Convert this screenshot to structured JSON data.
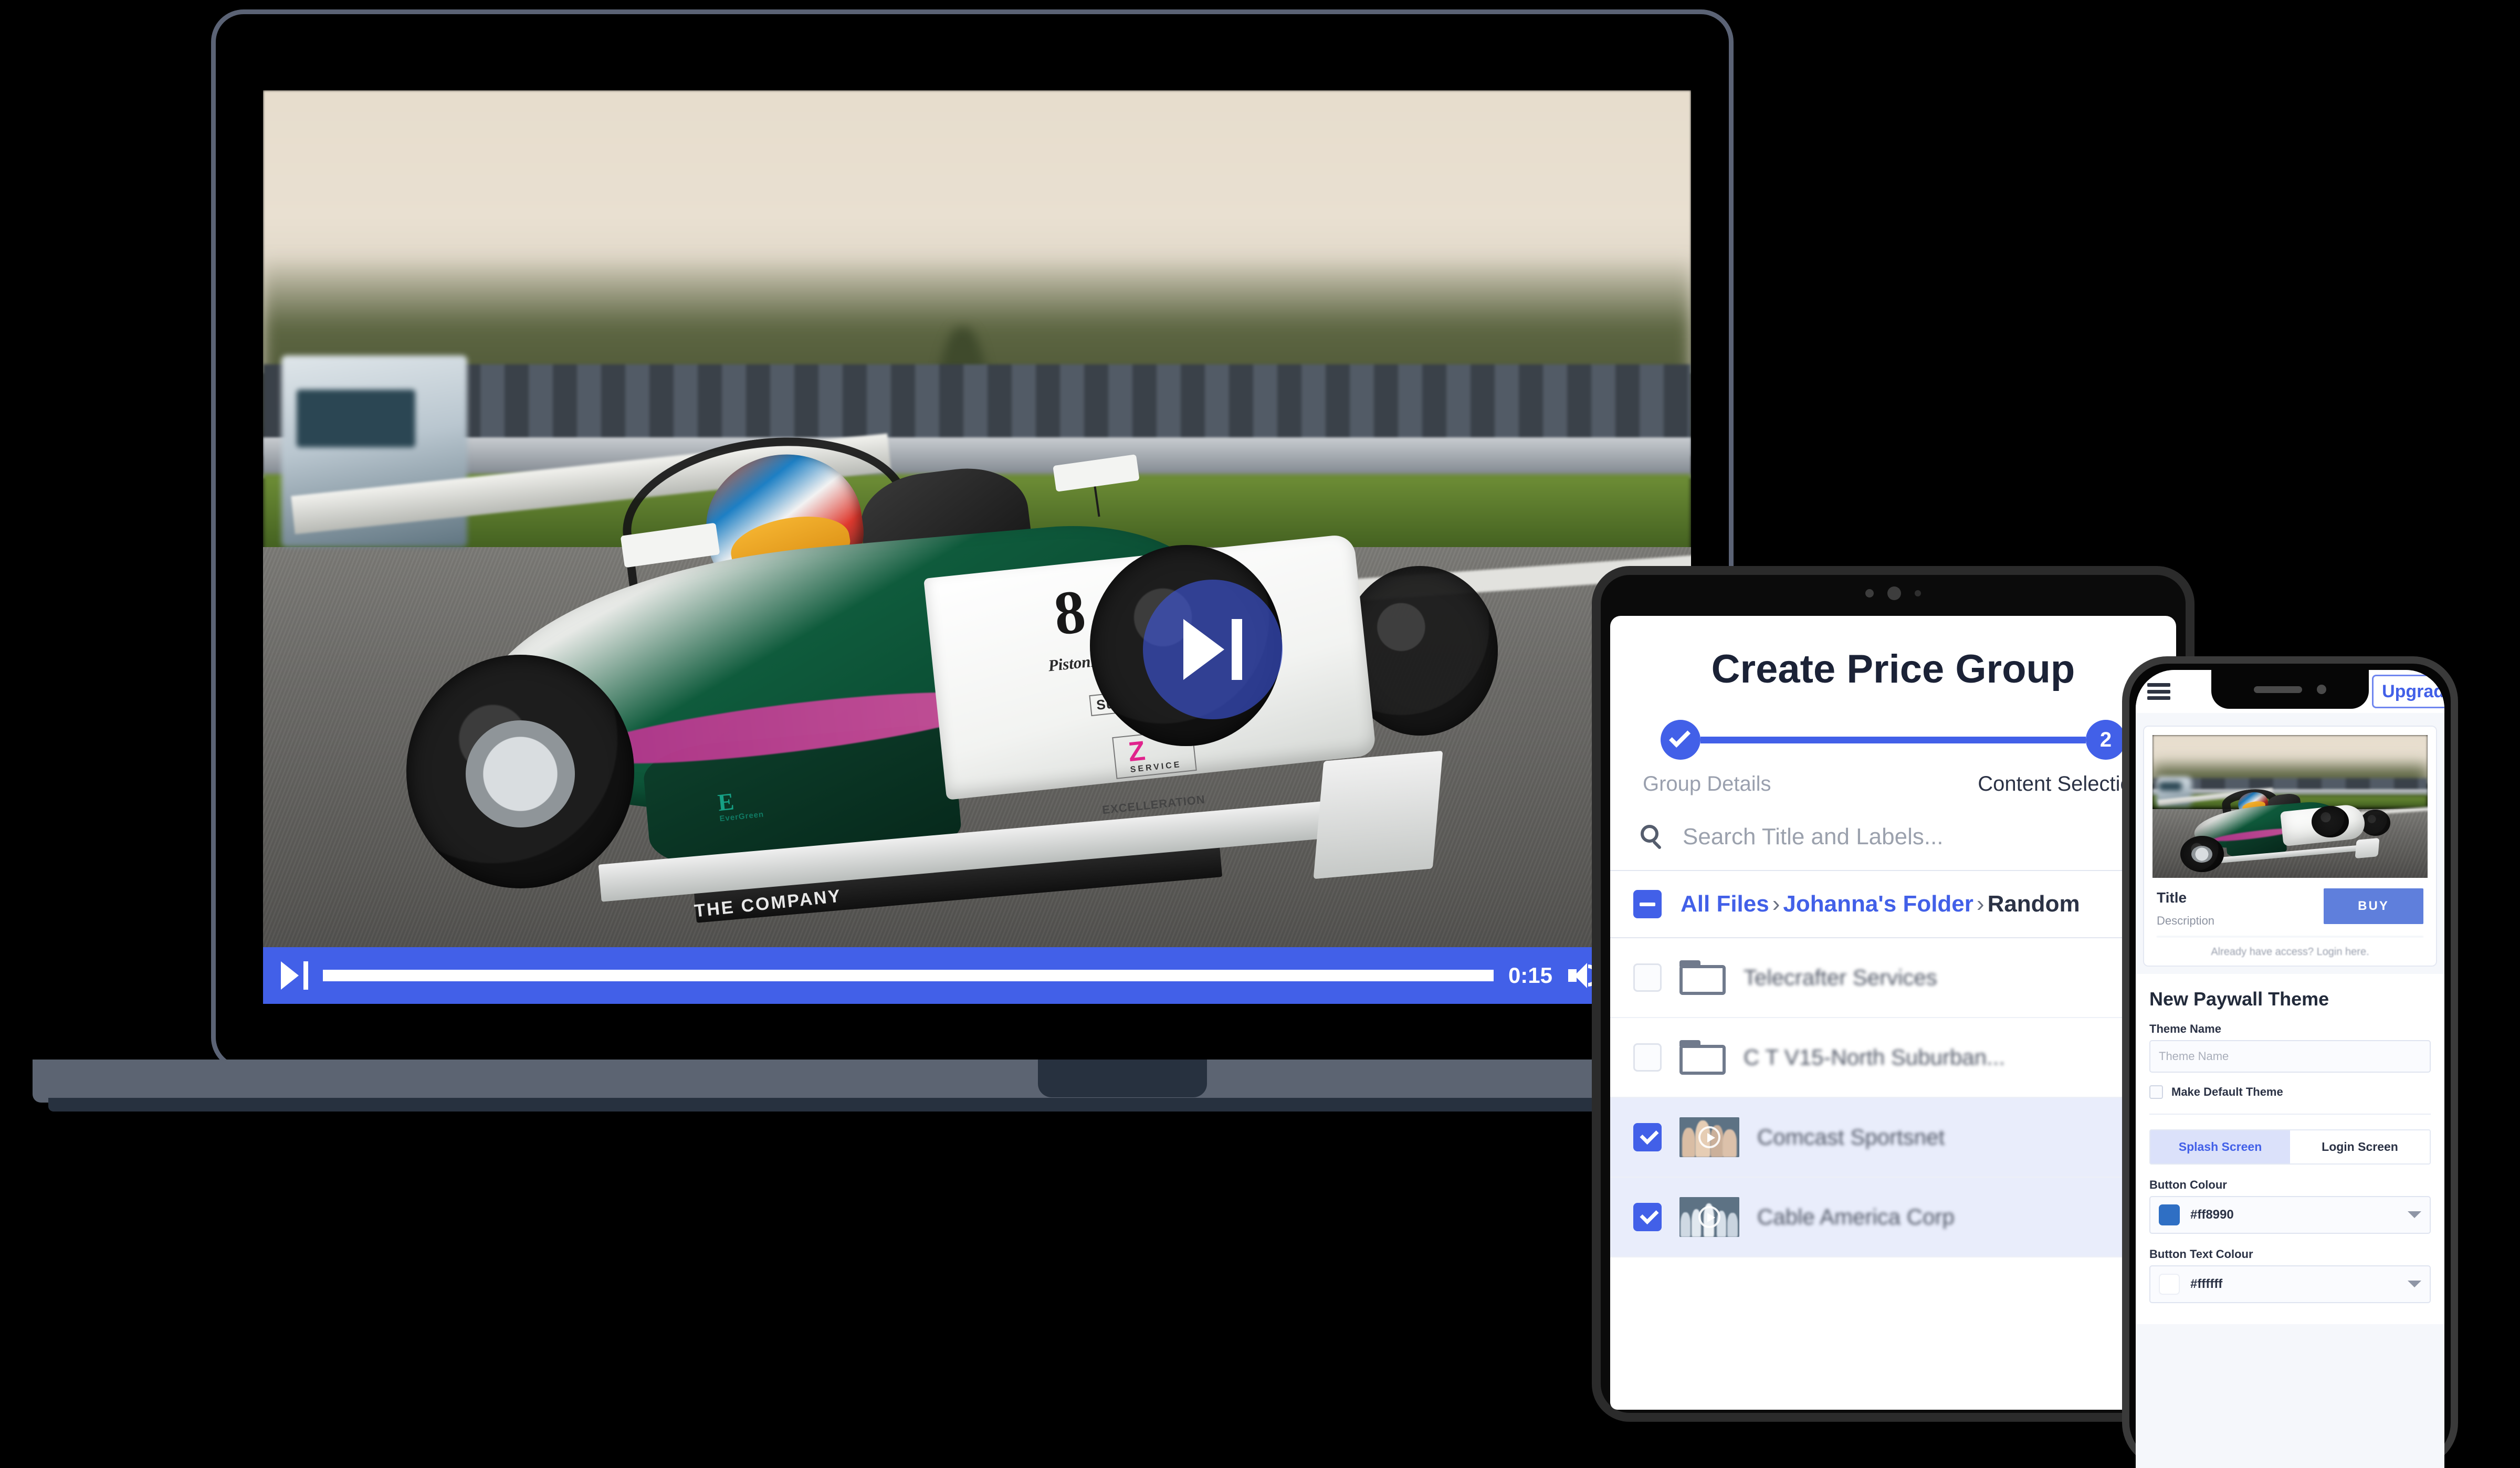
{
  "colors": {
    "brand_blue": "#4260e8",
    "laptop_frame": "#5b6375",
    "device_black": "#2b2b2b",
    "selected_row": "#e9edfb",
    "page_background": "#000000"
  },
  "laptop": {
    "device": "laptop",
    "video": {
      "scene": "formula-race-car-on-track",
      "car_markings": {
        "number": "8",
        "sponsor_primary": "PistonRingsGroup",
        "sponsor_secondary": "Sumptuous",
        "sponsor_logo": "Z",
        "sponsor_logo_sub": "SERVICE",
        "sponsor_tag": "EXCELLERATION",
        "sponsor_eco": "E",
        "sponsor_eco_sub": "EverGreen",
        "chassis_text": "THE COMPANY"
      },
      "overlay_play_icon": "skip-next-icon"
    },
    "player": {
      "play_icon": "skip-next-icon",
      "time": "0:15",
      "progress_percent": 100,
      "volume_icon": "volume-icon",
      "rewind_icon": "rewind-icon"
    }
  },
  "tablet": {
    "device": "tablet",
    "title": "Create Price Group",
    "stepper": {
      "steps": [
        {
          "label": "Group Details",
          "state": "complete",
          "marker": "check-icon"
        },
        {
          "label": "Content Selection",
          "state": "active",
          "marker": "2"
        }
      ]
    },
    "search": {
      "icon": "search-icon",
      "placeholder": "Search Title and Labels..."
    },
    "breadcrumb": {
      "checkbox_state": "indeterminate",
      "parts": [
        {
          "text": "All Files",
          "type": "link"
        },
        {
          "text": "›",
          "type": "separator"
        },
        {
          "text": "Johanna's Folder",
          "type": "link"
        },
        {
          "text": "›",
          "type": "separator"
        },
        {
          "text": "Random",
          "type": "current"
        }
      ]
    },
    "files": [
      {
        "name": "Telecrafter Services",
        "kind": "folder",
        "checked": false
      },
      {
        "name": "C T V15-North Suburban...",
        "kind": "folder",
        "checked": false
      },
      {
        "name": "Comcast Sportsnet",
        "kind": "video",
        "checked": true
      },
      {
        "name": "Cable America Corp",
        "kind": "video",
        "checked": true
      }
    ]
  },
  "phone": {
    "device": "phone",
    "topbar": {
      "menu_icon": "hamburger-menu-icon",
      "upgrade_label": "Upgrade"
    },
    "paywall_preview": {
      "title": "Title",
      "description": "Description",
      "buy_label": "BUY",
      "login_prompt": "Already have access? Login here."
    },
    "theme_form": {
      "heading": "New Paywall Theme",
      "theme_name_label": "Theme Name",
      "theme_name_value": "",
      "theme_name_placeholder": "Theme Name",
      "make_default_label": "Make Default Theme",
      "make_default_checked": false,
      "tabs": [
        {
          "label": "Splash Screen",
          "active": true
        },
        {
          "label": "Login Screen",
          "active": false
        }
      ],
      "button_colour_label": "Button Colour",
      "button_colour_value": "#ff8990",
      "button_colour_swatch": "#2f6fc4",
      "button_text_colour_label": "Button Text Colour",
      "button_text_colour_value": "#ffffff",
      "button_text_colour_swatch": "#ffffff",
      "dropdown_icon": "chevron-down-icon"
    }
  }
}
